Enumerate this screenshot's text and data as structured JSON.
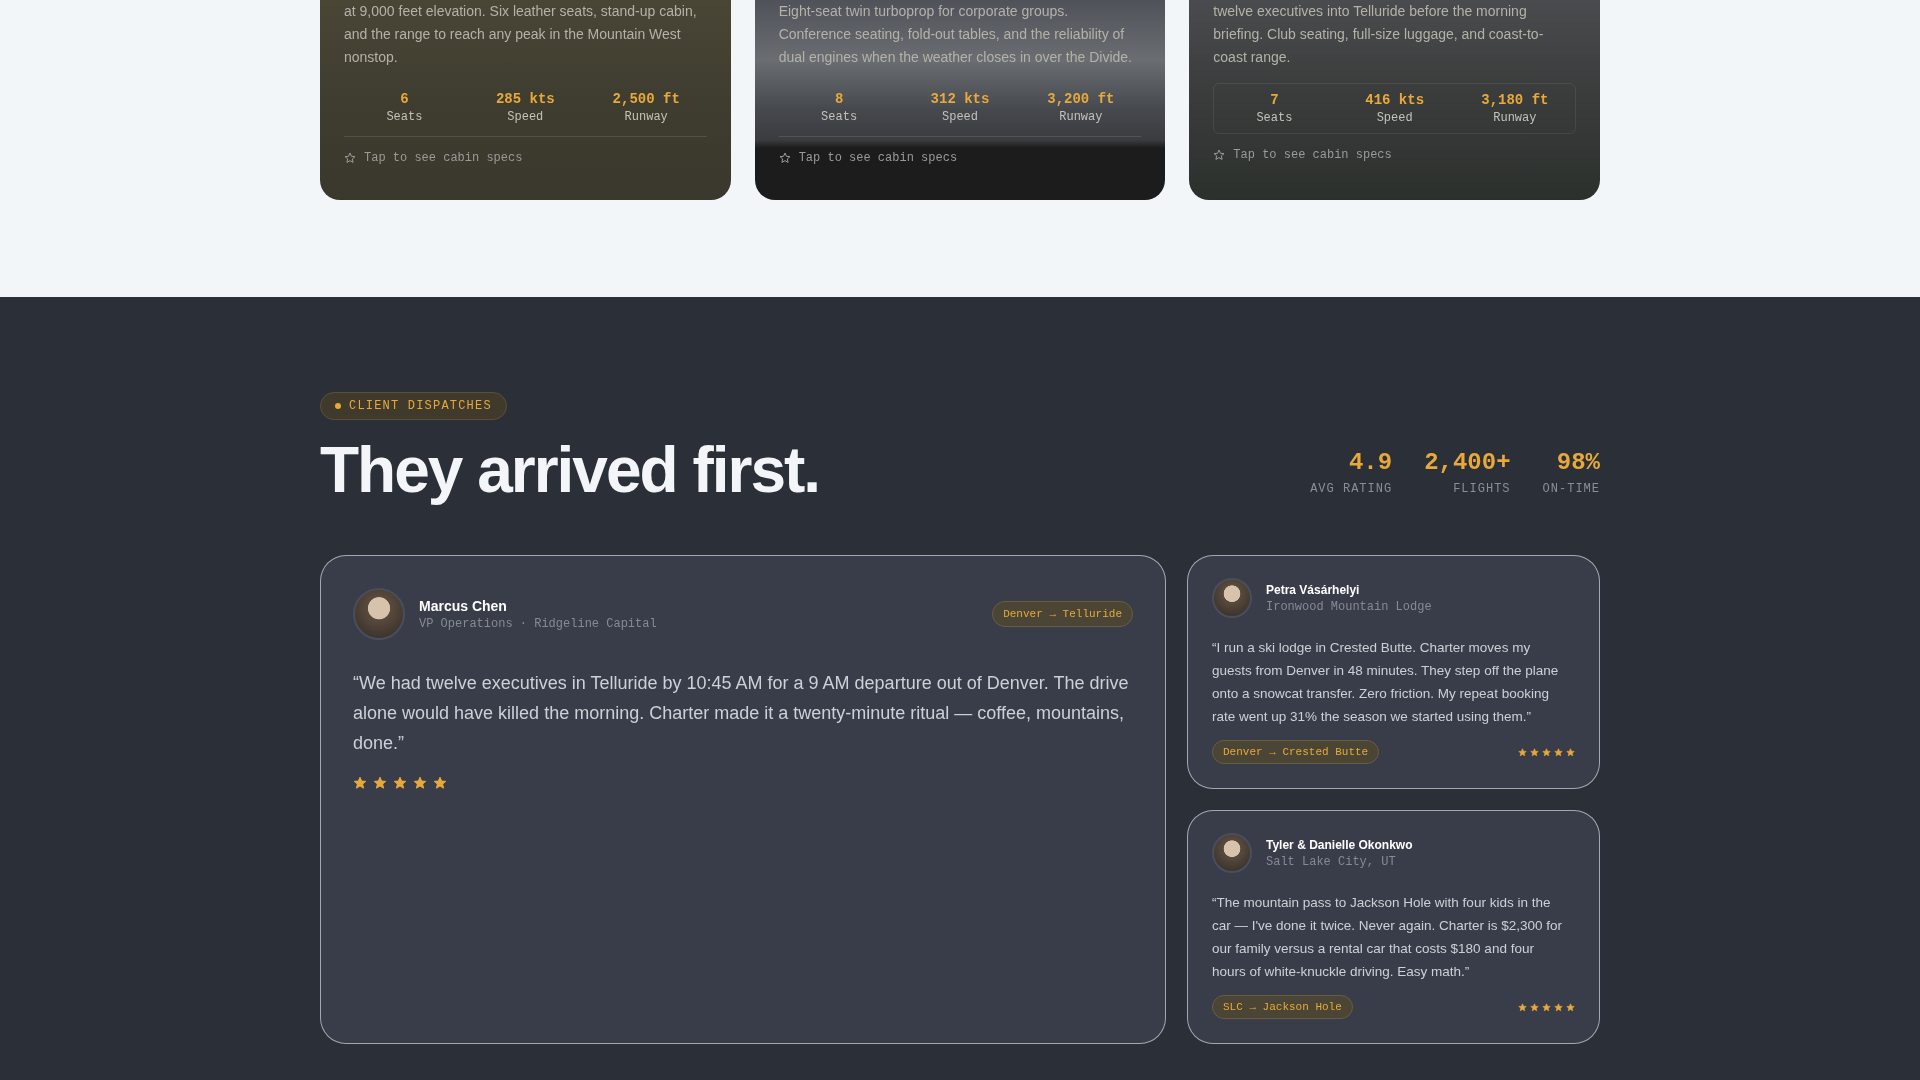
{
  "aircraft_cards": [
    {
      "description": "at 9,000 feet elevation. Six leather seats, stand-up cabin, and the range to reach any peak in the Mountain West nonstop.",
      "stats": [
        {
          "value": "6",
          "label": "Seats"
        },
        {
          "value": "285 kts",
          "label": "Speed"
        },
        {
          "value": "2,500 ft",
          "label": "Runway"
        }
      ],
      "hint": "Tap to see cabin specs"
    },
    {
      "description": "Eight-seat twin turboprop for corporate groups. Conference seating, fold-out tables, and the reliability of dual engines when the weather closes in over the Divide.",
      "stats": [
        {
          "value": "8",
          "label": "Seats"
        },
        {
          "value": "312 kts",
          "label": "Speed"
        },
        {
          "value": "3,200 ft",
          "label": "Runway"
        }
      ],
      "hint": "Tap to see cabin specs"
    },
    {
      "description": "twelve executives into Telluride before the morning briefing. Club seating, full-size luggage, and coast-to-coast range.",
      "stats": [
        {
          "value": "7",
          "label": "Seats"
        },
        {
          "value": "416 kts",
          "label": "Speed"
        },
        {
          "value": "3,180 ft",
          "label": "Runway"
        }
      ],
      "hint": "Tap to see cabin specs"
    }
  ],
  "dispatches": {
    "badge": "CLIENT DISPATCHES",
    "heading": "They arrived first.",
    "metrics": [
      {
        "value": "4.9",
        "label": "AVG RATING"
      },
      {
        "value": "2,400+",
        "label": "FLIGHTS"
      },
      {
        "value": "98%",
        "label": "ON-TIME"
      }
    ],
    "testimonials": [
      {
        "kind": "featured",
        "name": "Marcus Chen",
        "subtitle": "VP Operations · Ridgeline Capital",
        "route": "Denver → Telluride",
        "quote": "“We had twelve executives in Telluride by 10:45 AM for a 9 AM departure out of Denver. The drive alone would have killed the morning. Charter made it a twenty-minute ritual — coffee, mountains, done.”",
        "stars": 5
      },
      {
        "kind": "compact",
        "name": "Petra Vásárhelyi",
        "subtitle": "Ironwood Mountain Lodge",
        "route": "Denver → Crested Butte",
        "quote": "“I run a ski lodge in Crested Butte. Charter moves my guests from Denver in 48 minutes. They step off the plane onto a snowcat transfer. Zero friction. My repeat booking rate went up 31% the season we started using them.”",
        "stars": 5
      },
      {
        "kind": "compact",
        "name": "Tyler & Danielle Okonkwo",
        "subtitle": "Salt Lake City, UT",
        "route": "SLC → Jackson Hole",
        "quote": "“The mountain pass to Jackson Hole with four kids in the car — I've done it twice. Never again. Charter is $2,300 for our family versus a rental car that costs $180 and four hours of white-knuckle driving. Easy math.”",
        "stars": 5
      }
    ]
  }
}
